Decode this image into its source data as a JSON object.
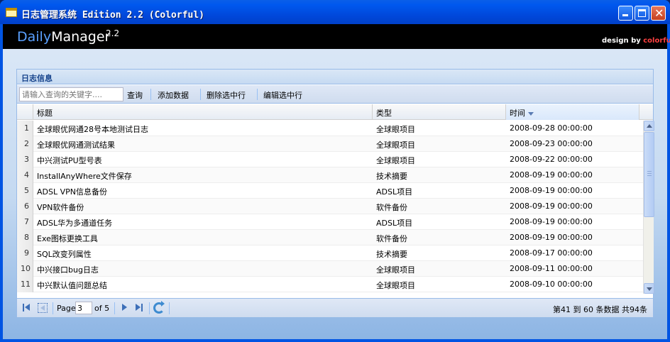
{
  "window": {
    "title": "日志管理系统 Edition 2.2 (Colorful)",
    "min_icon": "minimize-icon",
    "max_icon": "maximize-icon",
    "close_icon": "close-icon"
  },
  "banner": {
    "brand_prefix": "Daily",
    "brand_suffix": "Manager",
    "version": "2.2",
    "credit_prefix": "design by ",
    "credit_name": "colorful"
  },
  "panel": {
    "title": "日志信息"
  },
  "toolbar": {
    "search_placeholder": "请输入查询的关键字....",
    "query_label": "查询",
    "add_label": "添加数据",
    "delete_label": "删除选中行",
    "edit_label": "编辑选中行"
  },
  "grid": {
    "columns": [
      "标题",
      "类型",
      "时间"
    ],
    "sorted_column": "时间",
    "sort_direction": "desc",
    "rows": [
      {
        "n": "1",
        "title": "全球眼优网通28号本地测试日志",
        "type": "全球眼项目",
        "time": "2008-09-28 00:00:00"
      },
      {
        "n": "2",
        "title": "全球眼优网通测试结果",
        "type": "全球眼项目",
        "time": "2008-09-23 00:00:00"
      },
      {
        "n": "3",
        "title": "中兴测试PU型号表",
        "type": "全球眼项目",
        "time": "2008-09-22 00:00:00"
      },
      {
        "n": "4",
        "title": "InstallAnyWhere文件保存",
        "type": "技术摘要",
        "time": "2008-09-19 00:00:00"
      },
      {
        "n": "5",
        "title": "ADSL VPN信息备份",
        "type": "ADSL项目",
        "time": "2008-09-19 00:00:00"
      },
      {
        "n": "6",
        "title": "VPN软件备份",
        "type": "软件备份",
        "time": "2008-09-19 00:00:00"
      },
      {
        "n": "7",
        "title": "ADSL华为多通道任务",
        "type": "ADSL项目",
        "time": "2008-09-19 00:00:00"
      },
      {
        "n": "8",
        "title": "Exe图标更换工具",
        "type": "软件备份",
        "time": "2008-09-19 00:00:00"
      },
      {
        "n": "9",
        "title": "SQL改变列属性",
        "type": "技术摘要",
        "time": "2008-09-17 00:00:00"
      },
      {
        "n": "10",
        "title": "中兴接口bug日志",
        "type": "全球眼项目",
        "time": "2008-09-11 00:00:00"
      },
      {
        "n": "11",
        "title": "中兴默认值问题总结",
        "type": "全球眼项目",
        "time": "2008-09-10 00:00:00"
      }
    ]
  },
  "pager": {
    "page_label": "Page",
    "current_page": "3",
    "of_label": "of 5",
    "info": "第41 到  60 条数据  共94条"
  },
  "colors": {
    "titlebar": "#0054e3",
    "panel_title": "#15428b",
    "banner_bg": "#000000"
  }
}
